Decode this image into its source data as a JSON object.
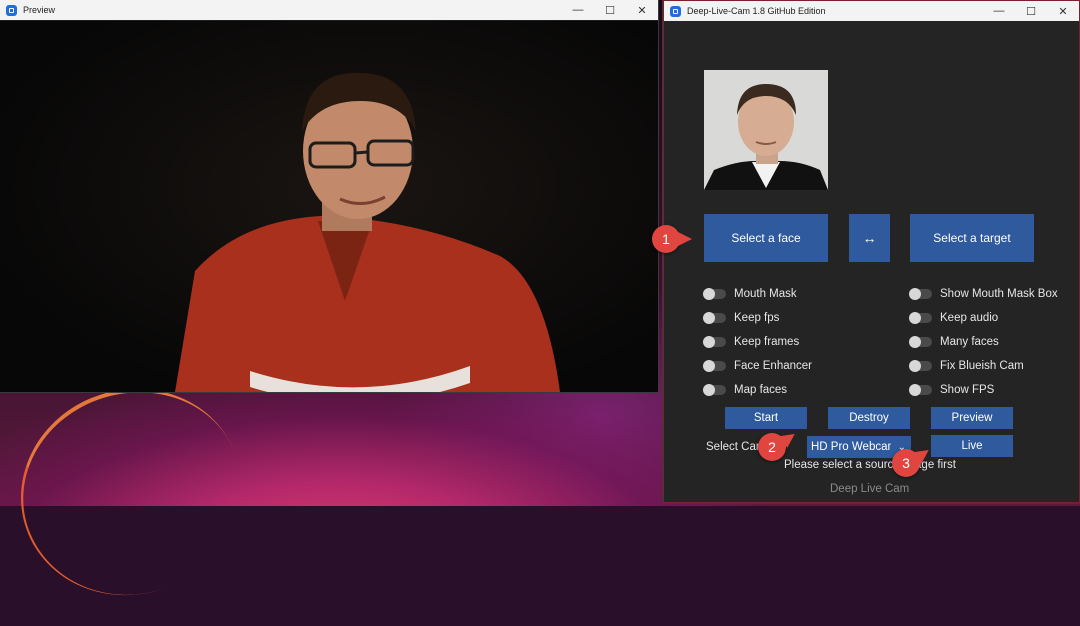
{
  "preview_window": {
    "title": "Preview",
    "controls": {
      "minimize": "—",
      "maximize": "☐",
      "close": "✕"
    }
  },
  "app_window": {
    "title": "Deep-Live-Cam 1.8 GitHub Edition",
    "controls": {
      "minimize": "—",
      "maximize": "☐",
      "close": "✕"
    }
  },
  "buttons": {
    "select_face": "Select a face",
    "swap": "↔",
    "select_target": "Select a target",
    "start": "Start",
    "destroy": "Destroy",
    "preview": "Preview",
    "live": "Live"
  },
  "toggles_left": [
    "Mouth Mask",
    "Keep fps",
    "Keep frames",
    "Face Enhancer",
    "Map faces"
  ],
  "toggles_right": [
    "Show Mouth Mask Box",
    "Keep audio",
    "Many faces",
    "Fix Blueish Cam",
    "Show FPS"
  ],
  "camera": {
    "label": "Select Camera",
    "selected": "HD Pro Webcam"
  },
  "status": "Please select a source image first",
  "footer": "Deep Live Cam",
  "callouts": [
    "1",
    "2",
    "3"
  ],
  "colors": {
    "accent": "#2f5a9e",
    "callout": "#e0463f",
    "window_border": "#7a2030"
  }
}
